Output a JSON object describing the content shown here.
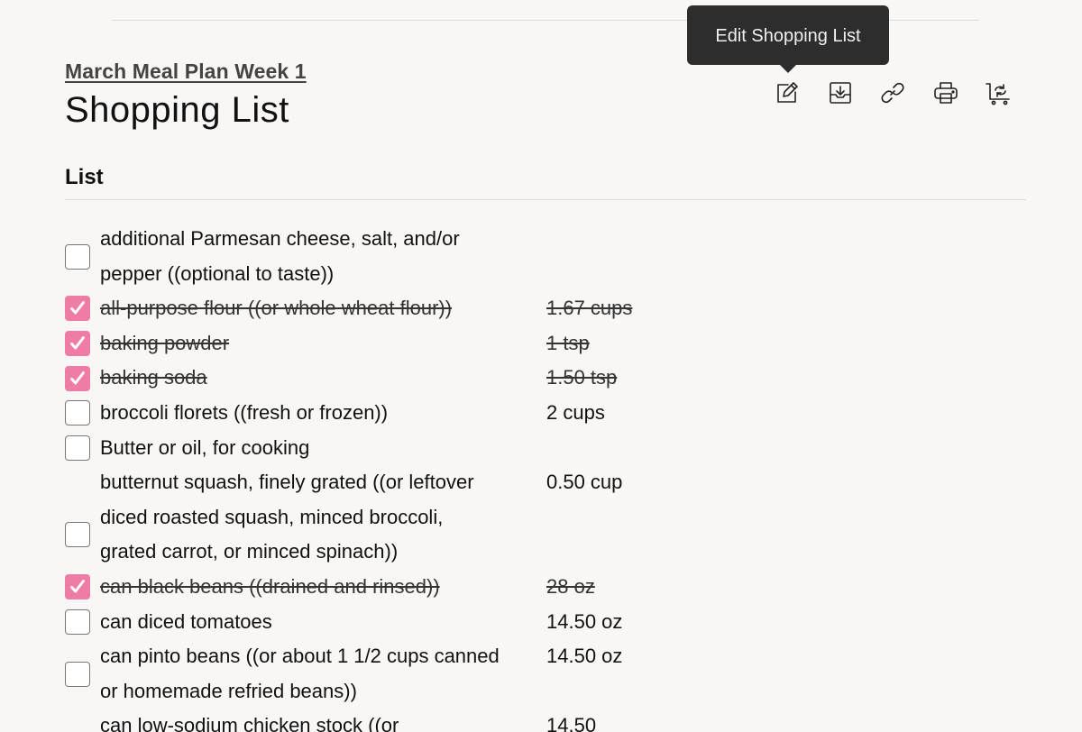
{
  "header": {
    "breadcrumb": "March Meal Plan Week 1",
    "title": "Shopping List"
  },
  "tooltip": "Edit Shopping List",
  "toolbar": [
    {
      "name": "edit-icon",
      "label": "Edit Shopping List"
    },
    {
      "name": "download-icon",
      "label": "Download"
    },
    {
      "name": "link-icon",
      "label": "Copy Link"
    },
    {
      "name": "print-icon",
      "label": "Print"
    },
    {
      "name": "cart-refresh-icon",
      "label": "Refresh Cart"
    }
  ],
  "section": {
    "title": "List"
  },
  "colors": {
    "accent": "#ef7ca6",
    "tooltip_bg": "#2d2d2d"
  },
  "items": [
    {
      "name": "additional Parmesan cheese, salt, and/or pepper ((optional to taste))",
      "qty": "",
      "checked": false
    },
    {
      "name": "all-purpose flour ((or whole wheat flour))",
      "qty": "1.67 cups",
      "checked": true
    },
    {
      "name": "baking powder",
      "qty": "1 tsp",
      "checked": true
    },
    {
      "name": "baking soda",
      "qty": "1.50 tsp",
      "checked": true
    },
    {
      "name": "broccoli florets ((fresh or frozen))",
      "qty": "2 cups",
      "checked": false
    },
    {
      "name": "Butter or oil, for cooking",
      "qty": "",
      "checked": false
    },
    {
      "name": "butternut squash, finely grated ((or leftover diced roasted squash, minced broccoli, grated carrot, or minced spinach))",
      "qty": "0.50 cup",
      "checked": false
    },
    {
      "name": "can black beans ((drained and rinsed))",
      "qty": "28 oz",
      "checked": true
    },
    {
      "name": "can diced tomatoes",
      "qty": "14.50 oz",
      "checked": false
    },
    {
      "name": "can pinto beans ((or about 1 1/2 cups canned or homemade refried beans))",
      "qty": "14.50 oz",
      "checked": false
    },
    {
      "name": "can low-sodium chicken stock ((or",
      "qty": "14.50",
      "checked": false
    }
  ]
}
